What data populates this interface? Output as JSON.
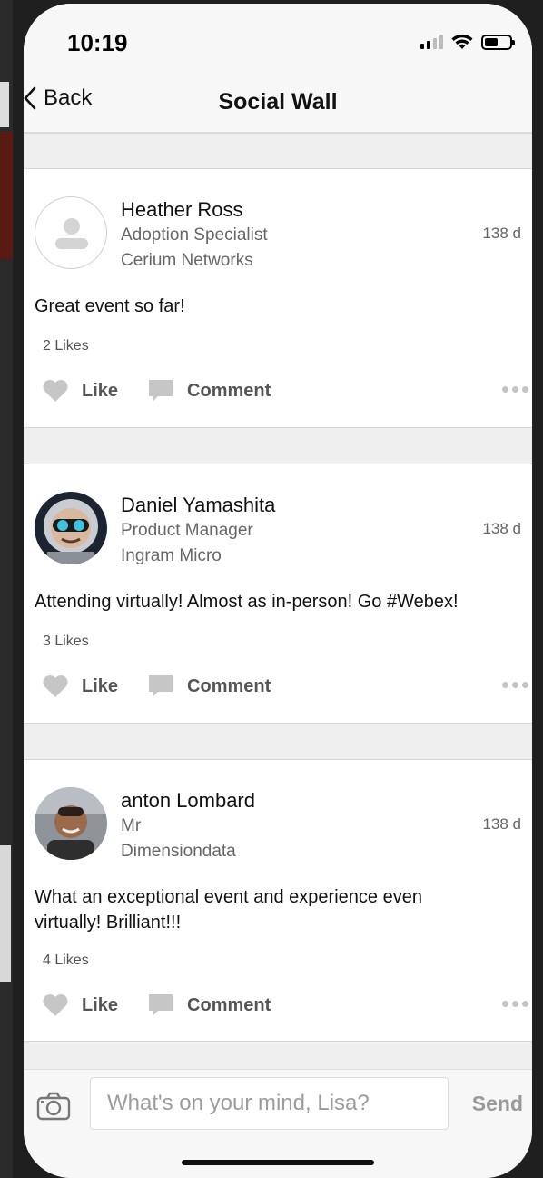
{
  "status_bar": {
    "time": "10:19"
  },
  "nav": {
    "back_label": "Back",
    "title": "Social Wall"
  },
  "posts": [
    {
      "name": "Heather Ross",
      "role": "Adoption Specialist",
      "company": "Cerium Networks",
      "age": "138 d",
      "text": "Great event so far!",
      "likes": "2 Likes",
      "avatar": "placeholder-person-icon"
    },
    {
      "name": "Daniel Yamashita",
      "role": "Product Manager",
      "company": "Ingram Micro",
      "age": "138 d",
      "text": "Attending virtually! Almost as in-person! Go #Webex!",
      "likes": "3 Likes",
      "avatar": "photo-astronaut"
    },
    {
      "name": "anton Lombard",
      "role": "Mr",
      "company": "Dimensiondata",
      "age": "138 d",
      "text": "What an exceptional event and experience even virtually! Brilliant!!!",
      "likes": "4 Likes",
      "avatar": "photo-person"
    }
  ],
  "actions": {
    "like_label": "Like",
    "comment_label": "Comment"
  },
  "composer": {
    "placeholder": "What's on your mind, Lisa?",
    "send_label": "Send"
  },
  "icons": [
    "signal-icon",
    "wifi-icon",
    "battery-icon",
    "back-chevron-icon",
    "heart-icon",
    "comment-icon",
    "more-icon",
    "camera-icon"
  ],
  "colors": {
    "background": "#f2f2f2",
    "card": "#ffffff",
    "muted_text": "#666666",
    "action": "#555555"
  }
}
